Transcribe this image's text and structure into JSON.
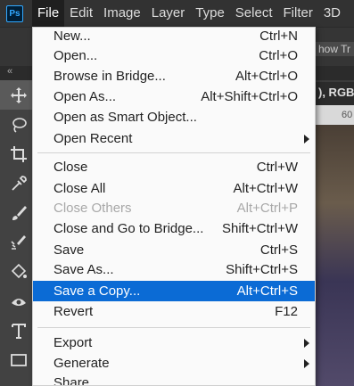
{
  "app": {
    "logo_text": "Ps"
  },
  "menubar": {
    "items": [
      "File",
      "Edit",
      "Image",
      "Layer",
      "Type",
      "Select",
      "Filter",
      "3D"
    ]
  },
  "options_bar": {
    "hint_text": "how Tr"
  },
  "document": {
    "tab_title": "), RGB",
    "ruler_label": "60"
  },
  "toolbar": {
    "tools": [
      "move-tool",
      "lasso-tool",
      "crop-tool",
      "eyedropper-tool",
      "brush-tool",
      "healing-brush-tool",
      "paint-bucket-tool",
      "blur-tool",
      "type-tool",
      "shape-tool"
    ],
    "collapse_glyph": "«"
  },
  "file_menu": {
    "items": [
      {
        "label": "New...",
        "shortcut": "Ctrl+N"
      },
      {
        "label": "Open...",
        "shortcut": "Ctrl+O"
      },
      {
        "label": "Browse in Bridge...",
        "shortcut": "Alt+Ctrl+O"
      },
      {
        "label": "Open As...",
        "shortcut": "Alt+Shift+Ctrl+O"
      },
      {
        "label": "Open as Smart Object...",
        "shortcut": ""
      },
      {
        "label": "Open Recent",
        "shortcut": "",
        "submenu": true
      },
      {
        "label": "Close",
        "shortcut": "Ctrl+W"
      },
      {
        "label": "Close All",
        "shortcut": "Alt+Ctrl+W"
      },
      {
        "label": "Close Others",
        "shortcut": "Alt+Ctrl+P",
        "disabled": true
      },
      {
        "label": "Close and Go to Bridge...",
        "shortcut": "Shift+Ctrl+W"
      },
      {
        "label": "Save",
        "shortcut": "Ctrl+S"
      },
      {
        "label": "Save As...",
        "shortcut": "Shift+Ctrl+S"
      },
      {
        "label": "Save a Copy...",
        "shortcut": "Alt+Ctrl+S",
        "highlighted": true
      },
      {
        "label": "Revert",
        "shortcut": "F12"
      },
      {
        "label": "Export",
        "shortcut": "",
        "submenu": true
      },
      {
        "label": "Generate",
        "shortcut": "",
        "submenu": true
      },
      {
        "label": "Share...",
        "shortcut": ""
      }
    ]
  },
  "colors": {
    "highlight": "#0b6bd5",
    "menu_bg": "#fafafa",
    "app_bg": "#3b3b3b"
  }
}
